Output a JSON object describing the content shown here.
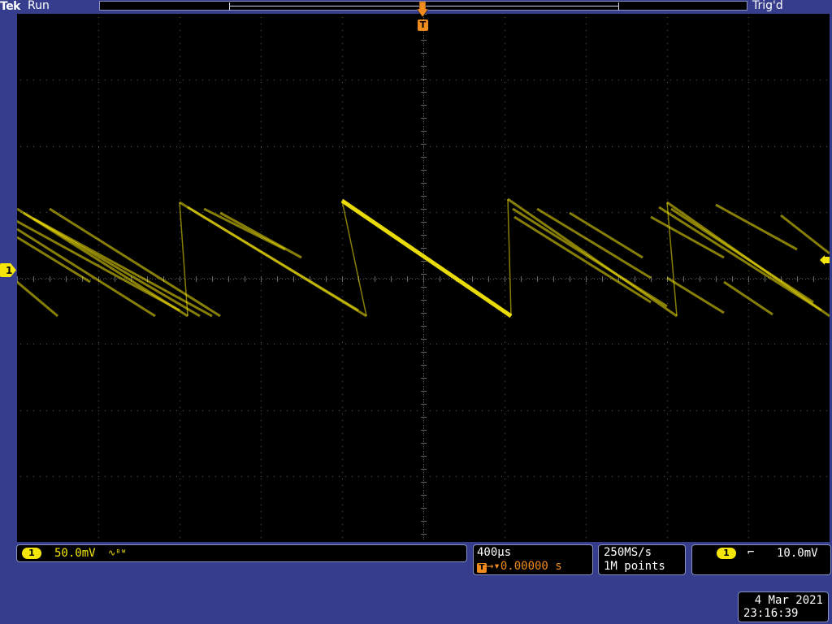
{
  "header": {
    "brand": "Tek",
    "run_state": "Run",
    "trigger_state": "Trig'd"
  },
  "markers": {
    "trigger_position_icon": "trigger-position-arrow",
    "trigger_label": "T",
    "channel_ref_label": "1",
    "trigger_level_icon": "trigger-level-arrow"
  },
  "channel1": {
    "badge": "1",
    "scale": "50.0mV",
    "coupling_icon": "∿ᴮᵂ",
    "color": "#f5e60a"
  },
  "timebase": {
    "scale": "400µs",
    "delay_icon": "T→▾",
    "delay": "0.00000 s"
  },
  "acquisition": {
    "sample_rate": "250MS/s",
    "record_length": "1M points"
  },
  "trigger": {
    "badge": "1",
    "slope_icon": "falling-edge",
    "slope_glyph": "⌐",
    "level": "10.0mV"
  },
  "clock": {
    "date": "4 Mar 2021",
    "time": "23:16:39"
  },
  "colors": {
    "background": "#353d8c",
    "trace": "#f5e60a",
    "trigger_marker": "#f08c1e"
  }
}
